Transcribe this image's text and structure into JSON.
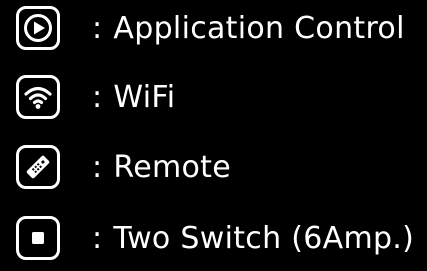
{
  "colors": {
    "background": "#000000",
    "foreground": "#ffffff"
  },
  "legend": {
    "items": [
      {
        "icon": "play-icon",
        "separator": ":",
        "label": "Application Control"
      },
      {
        "icon": "wifi-icon",
        "separator": ":",
        "label": "WiFi"
      },
      {
        "icon": "remote-icon",
        "separator": ":",
        "label": "Remote"
      },
      {
        "icon": "switch-icon",
        "separator": ":",
        "label": "Two Switch (6Amp.)"
      }
    ]
  }
}
